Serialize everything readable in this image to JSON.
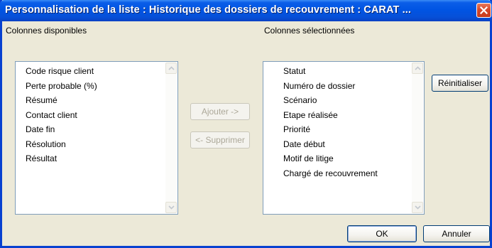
{
  "window": {
    "title": "Personnalisation de la liste : Historique des dossiers de recouvrement :  CARAT ..."
  },
  "available": {
    "label": "Colonnes disponibles",
    "items": [
      "Code risque client",
      "Perte probable (%)",
      "Résumé",
      "Contact client",
      "Date fin",
      "Résolution",
      "Résultat"
    ]
  },
  "selected": {
    "label": "Colonnes sélectionnées",
    "items": [
      "Statut",
      "Numéro de dossier",
      "Scénario",
      "Etape réalisée",
      "Priorité",
      "Date début",
      "Motif de litige",
      "Chargé de recouvrement"
    ]
  },
  "buttons": {
    "add": "Ajouter ->",
    "remove": "<- Supprimer",
    "reset": "Réinitialiser",
    "ok": "OK",
    "cancel": "Annuler"
  },
  "colors": {
    "titlebar": "#0054e3",
    "dialog_bg": "#ece9d8",
    "close": "#d6482a"
  },
  "icons": [
    "close-icon",
    "scroll-up-icon",
    "scroll-down-icon"
  ]
}
